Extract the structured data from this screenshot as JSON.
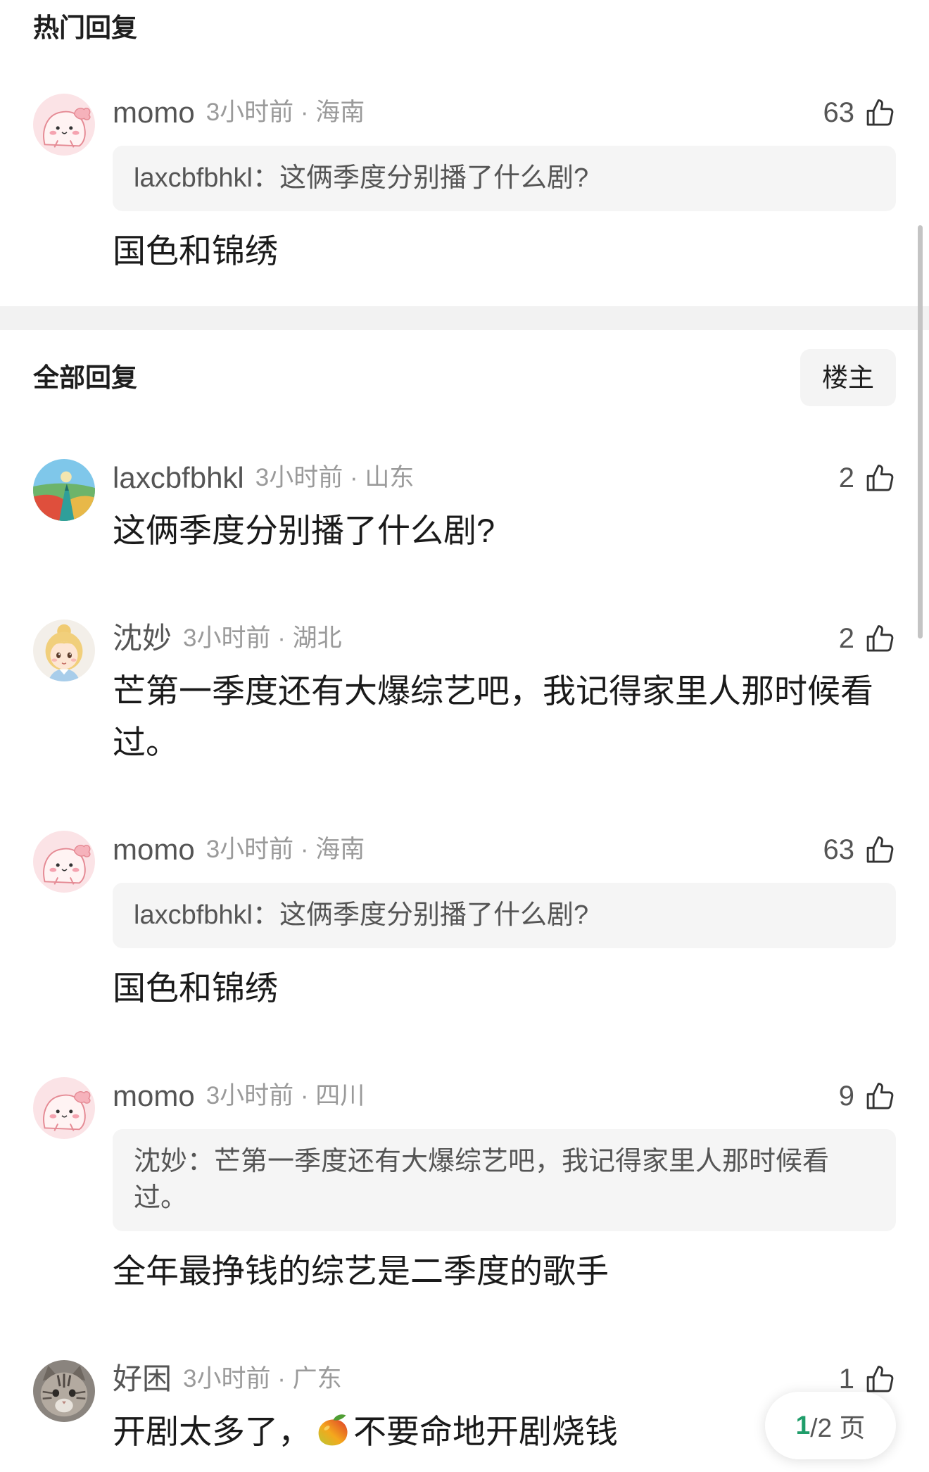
{
  "hot_section": {
    "title": "热门回复"
  },
  "hot_replies": [
    {
      "username": "momo",
      "meta": "3小时前 · 海南",
      "likes": "63",
      "quote": "laxcbfbhkl：这俩季度分别播了什么剧?",
      "content": "国色和锦绣"
    }
  ],
  "all_section": {
    "title": "全部回复",
    "filter_button": "楼主"
  },
  "replies": [
    {
      "username": "laxcbfbhkl",
      "meta": "3小时前 · 山东",
      "likes": "2",
      "content": "这俩季度分别播了什么剧?"
    },
    {
      "username": "沈妙",
      "meta": "3小时前 · 湖北",
      "likes": "2",
      "content": "芒第一季度还有大爆综艺吧，我记得家里人那时候看过。"
    },
    {
      "username": "momo",
      "meta": "3小时前 · 海南",
      "likes": "63",
      "quote": "laxcbfbhkl：这俩季度分别播了什么剧?",
      "content": "国色和锦绣"
    },
    {
      "username": "momo",
      "meta": "3小时前 · 四川",
      "likes": "9",
      "quote": "沈妙：芒第一季度还有大爆综艺吧，我记得家里人那时候看过。",
      "content": "全年最挣钱的综艺是二季度的歌手"
    },
    {
      "username": "好困",
      "meta": "3小时前 · 广东",
      "likes": "1",
      "content_before": "开剧太多了，",
      "content_emoji": "mango-emoji",
      "content_after": "不要命地开剧烧钱"
    }
  ],
  "pagination": {
    "current": "1",
    "rest": "/2 页"
  },
  "icons": {
    "like": "thumb-up-icon",
    "emoji": "mango-emoji"
  },
  "colors": {
    "accent_green": "#1f9d6a",
    "text_primary": "#1a1a1a",
    "text_secondary": "#9a9a9a",
    "quote_background": "#f5f5f5"
  }
}
